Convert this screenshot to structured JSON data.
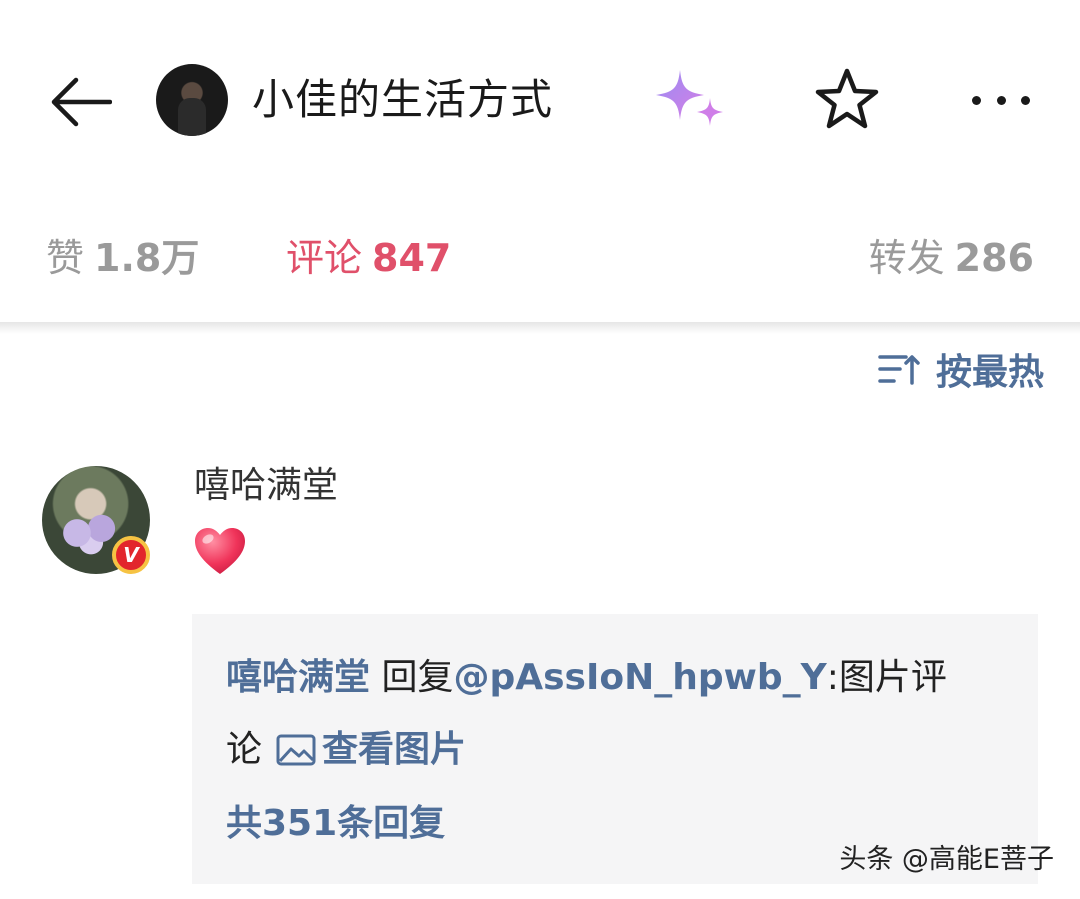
{
  "header": {
    "title": "小佳的生活方式"
  },
  "stats": {
    "likes_label": "赞",
    "likes_count": "1.8万",
    "comments_label": "评论",
    "comments_count": "847",
    "reposts_label": "转发",
    "reposts_count": "286"
  },
  "sort": {
    "label": "按最热"
  },
  "comment": {
    "author": "嘻哈满堂",
    "badge": "V",
    "reply": {
      "author": "嘻哈满堂",
      "verb": " 回复",
      "mention": "@pAssIoN_hpwb_Y",
      "text_a": ":图片评",
      "text_b": "论",
      "view_image": "查看图片",
      "more_replies": "共351条回复"
    }
  },
  "watermark": "头条 @高能E菩子",
  "colors": {
    "accent_red": "#e0506a",
    "link_blue": "#4f6e98",
    "muted_gray": "#9a9a9a",
    "reply_bg": "#f5f5f6"
  },
  "icons": [
    "back-arrow-icon",
    "sparkle-icon",
    "star-icon",
    "more-icon",
    "sort-icon",
    "heart-icon",
    "image-icon"
  ]
}
